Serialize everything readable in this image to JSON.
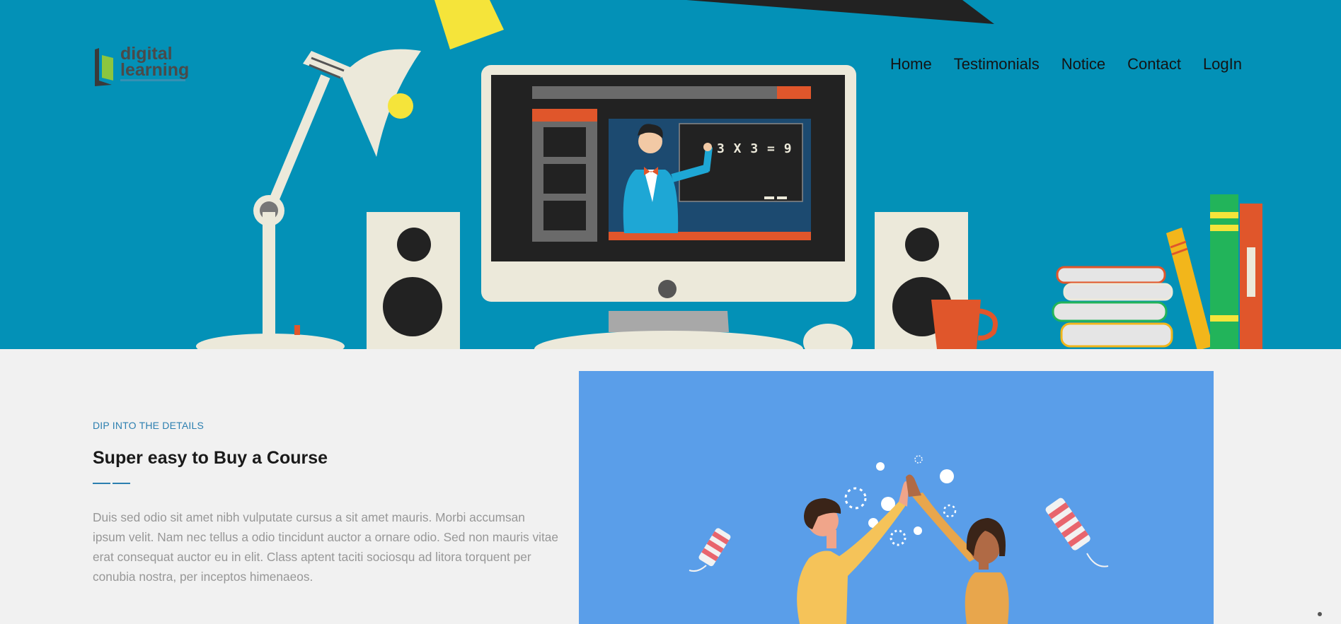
{
  "brand": {
    "line1": "digital",
    "line2": "learning",
    "colors": {
      "hero_bg": "#0391b7",
      "accent": "#2c7fb0",
      "illustration_bg": "#5a9ee9"
    }
  },
  "nav": {
    "items": [
      "Home",
      "Testimonials",
      "Notice",
      "Contact",
      "LogIn"
    ]
  },
  "hero": {
    "board_text": "3 X 3 = 9"
  },
  "section": {
    "eyebrow": "DIP INTO THE DETAILS",
    "title": "Super easy to Buy a Course",
    "body": "Duis sed odio sit amet nibh vulputate cursus a sit amet mauris. Morbi accumsan ipsum velit. Nam nec tellus a odio tincidunt auctor a ornare odio. Sed non mauris vitae erat consequat auctor eu in elit. Class aptent taciti sociosqu ad litora torquent per conubia nostra, per inceptos himenaeos."
  },
  "icons": {
    "logo": "book-logo-icon",
    "scroll": "scroll-indicator-icon"
  }
}
